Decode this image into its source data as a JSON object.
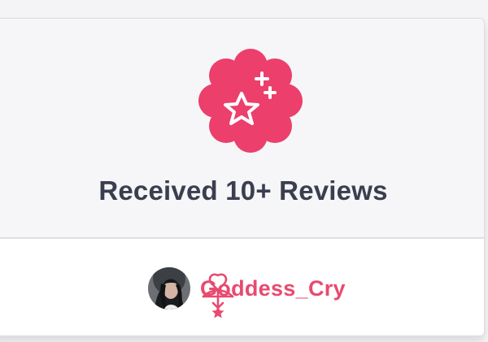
{
  "achievement": {
    "title": "Received 10+ Reviews",
    "badge_icon": "sparkle-star-icon",
    "badge_color": "#ec3f6b"
  },
  "user": {
    "username": "Goddess_Cry",
    "username_color": "#e84a6f",
    "avatar": "user-avatar",
    "mark_icon": "bow-arrow-icon"
  }
}
